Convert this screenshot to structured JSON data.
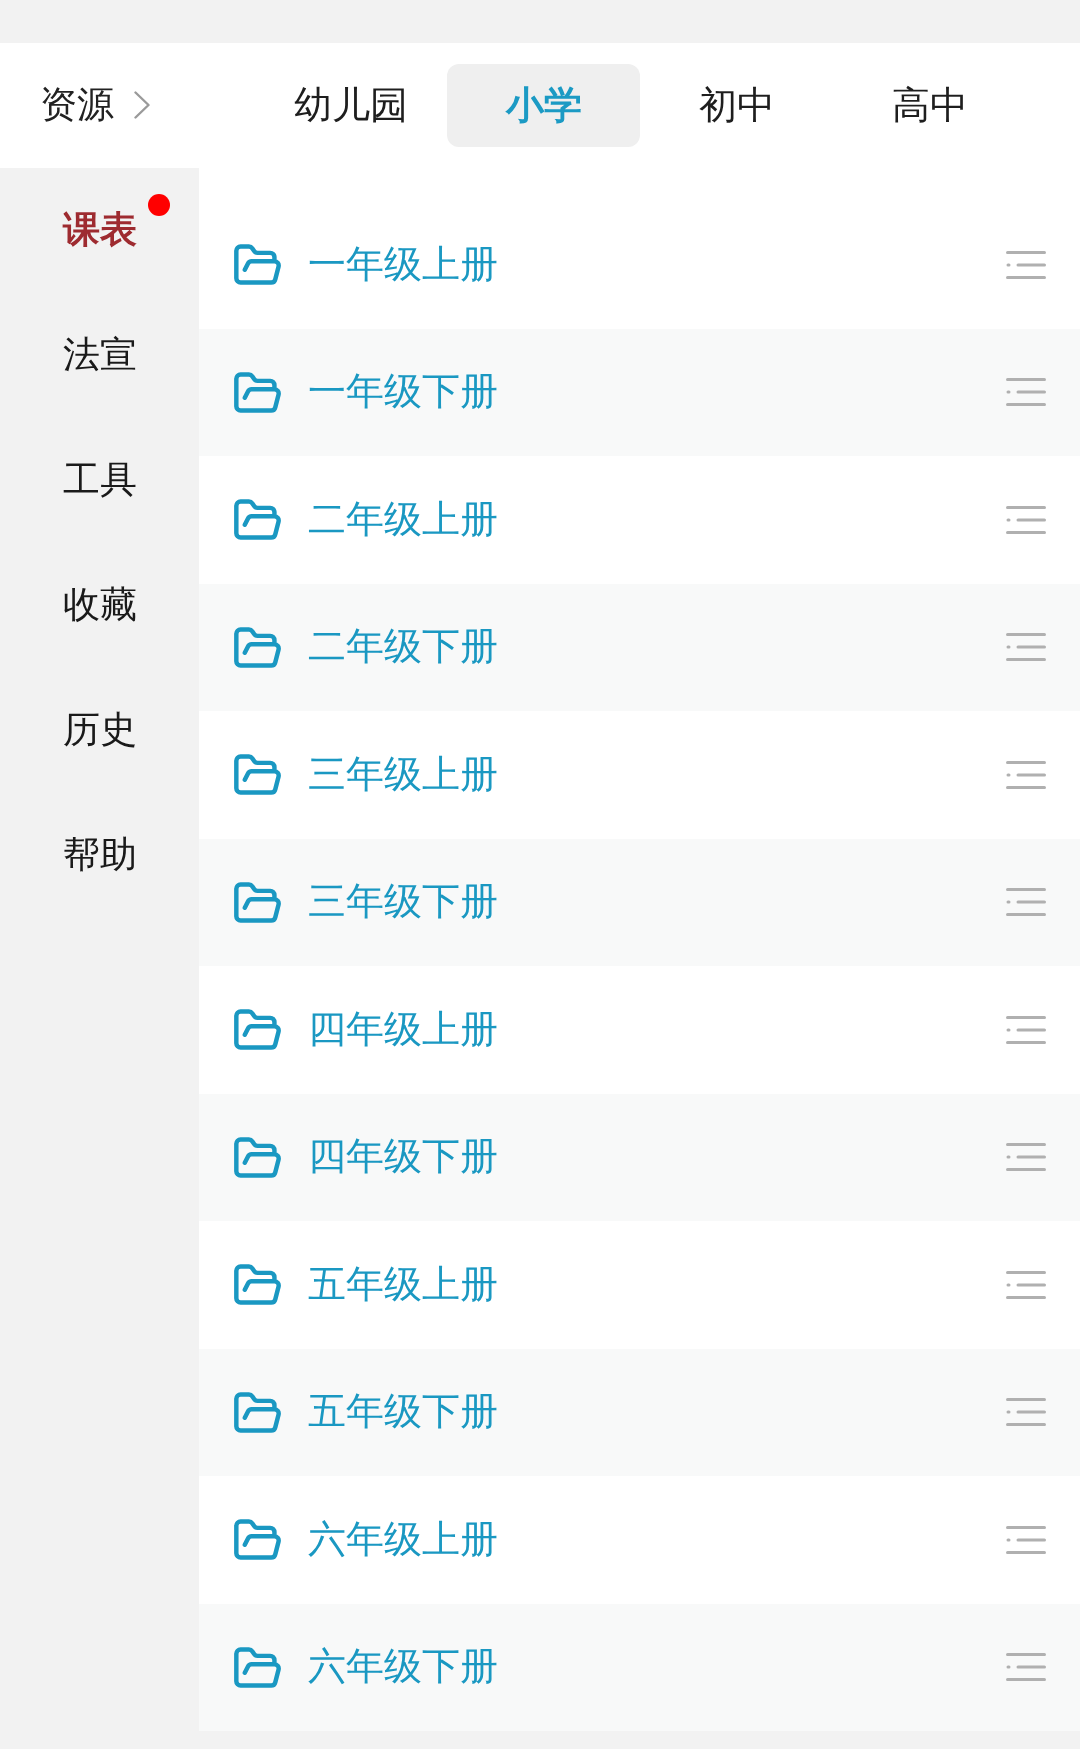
{
  "header": {
    "title": "资源"
  },
  "tabs": [
    {
      "label": "幼儿园",
      "selected": false
    },
    {
      "label": "小学",
      "selected": true
    },
    {
      "label": "初中",
      "selected": false
    },
    {
      "label": "高中",
      "selected": false
    }
  ],
  "sidebar": {
    "items": [
      {
        "label": "课表",
        "selected": true,
        "dot": true
      },
      {
        "label": "法宣",
        "selected": false,
        "dot": false
      },
      {
        "label": "工具",
        "selected": false,
        "dot": false
      },
      {
        "label": "收藏",
        "selected": false,
        "dot": false
      },
      {
        "label": "历史",
        "selected": false,
        "dot": false
      },
      {
        "label": "帮助",
        "selected": false,
        "dot": false
      }
    ]
  },
  "folders": [
    {
      "label": "一年级上册"
    },
    {
      "label": "一年级下册"
    },
    {
      "label": "二年级上册"
    },
    {
      "label": "二年级下册"
    },
    {
      "label": "三年级上册"
    },
    {
      "label": "三年级下册"
    },
    {
      "label": "四年级上册"
    },
    {
      "label": "四年级下册"
    },
    {
      "label": "五年级上册"
    },
    {
      "label": "五年级下册"
    },
    {
      "label": "六年级上册"
    },
    {
      "label": "六年级下册"
    }
  ]
}
